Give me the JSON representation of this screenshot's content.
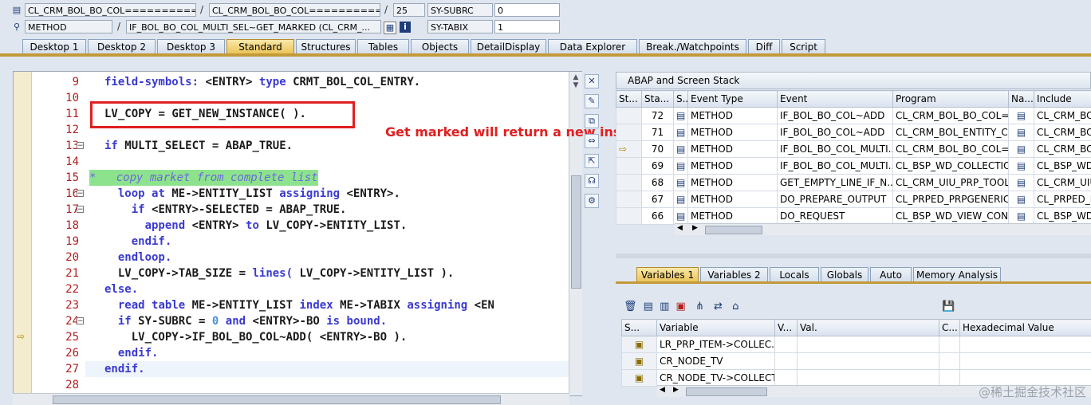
{
  "header": {
    "row1": {
      "f1": "CL_CRM_BOL_BO_COL============...",
      "f2": "CL_CRM_BOL_BO_COL=============...",
      "f3": "25",
      "f4": "SY-SUBRC",
      "f5": "0"
    },
    "row2": {
      "f1": "METHOD",
      "f2": "IF_BOL_BO_COL_MULTI_SEL~GET_MARKED (CL_CRM_...",
      "f3": "SY-TABIX",
      "f4": "1"
    }
  },
  "tabs": [
    "Desktop 1",
    "Desktop 2",
    "Desktop 3",
    "Standard",
    "Structures",
    "Tables",
    "Objects",
    "DetailDisplay",
    "Data Explorer",
    "Break./Watchpoints",
    "Diff",
    "Script"
  ],
  "editor": {
    "lines": [
      {
        "n": "9",
        "t": "field-symbols: <ENTRY> type CRMT_BOL_COL_ENTRY."
      },
      {
        "n": "10",
        "t": ""
      },
      {
        "n": "11",
        "t": "LV_COPY = GET_NEW_INSTANCE( )."
      },
      {
        "n": "12",
        "t": ""
      },
      {
        "n": "13",
        "t": "if MULTI_SELECT = ABAP_TRUE."
      },
      {
        "n": "14",
        "t": ""
      },
      {
        "n": "15",
        "t": "*   copy market from complete list"
      },
      {
        "n": "16",
        "t": "  loop at ME->ENTITY_LIST assigning <ENTRY>."
      },
      {
        "n": "17",
        "t": "    if <ENTRY>-SELECTED = ABAP_TRUE."
      },
      {
        "n": "18",
        "t": "      append <ENTRY> to LV_COPY->ENTITY_LIST."
      },
      {
        "n": "19",
        "t": "    endif."
      },
      {
        "n": "20",
        "t": "  endloop."
      },
      {
        "n": "21",
        "t": "  LV_COPY->TAB_SIZE = lines( LV_COPY->ENTITY_LIST )."
      },
      {
        "n": "22",
        "t": "else."
      },
      {
        "n": "23",
        "t": "  read table ME->ENTITY_LIST index ME->TABIX assigning <EN"
      },
      {
        "n": "24",
        "t": "  if SY-SUBRC = 0 and <ENTRY>-BO is bound."
      },
      {
        "n": "25",
        "t": "    LV_COPY->IF_BOL_BO_COL~ADD( <ENTRY>-BO )."
      },
      {
        "n": "26",
        "t": "  endif."
      },
      {
        "n": "27",
        "t": "endif."
      },
      {
        "n": "28",
        "t": ""
      }
    ],
    "annotation": "Get marked will return a new instance"
  },
  "stack": {
    "title": "ABAP and Screen Stack",
    "columns": [
      "St...",
      "Sta...",
      "S...",
      "Event Type",
      "Event",
      "Program",
      "Na...",
      "Include"
    ],
    "rows": [
      {
        "sta": "72",
        "type": "METHOD",
        "event": "IF_BOL_BO_COL~ADD",
        "program": "CL_CRM_BOL_BO_COL=...",
        "include": "CL_CRM_BOL"
      },
      {
        "sta": "71",
        "type": "METHOD",
        "event": "IF_BOL_BO_COL~ADD",
        "program": "CL_CRM_BOL_ENTITY_C...",
        "include": "CL_CRM_BOL"
      },
      {
        "sta": "70",
        "type": "METHOD",
        "event": "IF_BOL_BO_COL_MULTI...",
        "program": "CL_CRM_BOL_BO_COL=...",
        "include": "CL_CRM_BOL"
      },
      {
        "sta": "69",
        "type": "METHOD",
        "event": "IF_BOL_BO_COL_MULTI...",
        "program": "CL_BSP_WD_COLLECTIO...",
        "include": "CL_BSP_WD_"
      },
      {
        "sta": "68",
        "type": "METHOD",
        "event": "GET_EMPTY_LINE_IF_N...",
        "program": "CL_CRM_UIU_PRP_TOOL...",
        "include": "CL_CRM_UIU"
      },
      {
        "sta": "67",
        "type": "METHOD",
        "event": "DO_PREPARE_OUTPUT",
        "program": "CL_PRPED_PRPGENERIC...",
        "include": "CL_PRPED_P"
      },
      {
        "sta": "66",
        "type": "METHOD",
        "event": "DO_REQUEST",
        "program": "CL_BSP_WD_VIEW_CON...",
        "include": "CL_BSP_WD_"
      }
    ]
  },
  "vartabs": [
    "Variables 1",
    "Variables 2",
    "Locals",
    "Globals",
    "Auto",
    "Memory Analysis"
  ],
  "vars": {
    "columns": [
      "S...",
      "Variable",
      "V...",
      "Val.",
      "C...",
      "Hexadecimal Value"
    ],
    "rows": [
      "LR_PRP_ITEM->COLLEC...",
      "CR_NODE_TV",
      "CR_NODE_TV->COLLECT..."
    ]
  },
  "watermark": "@稀土掘金技术社区"
}
